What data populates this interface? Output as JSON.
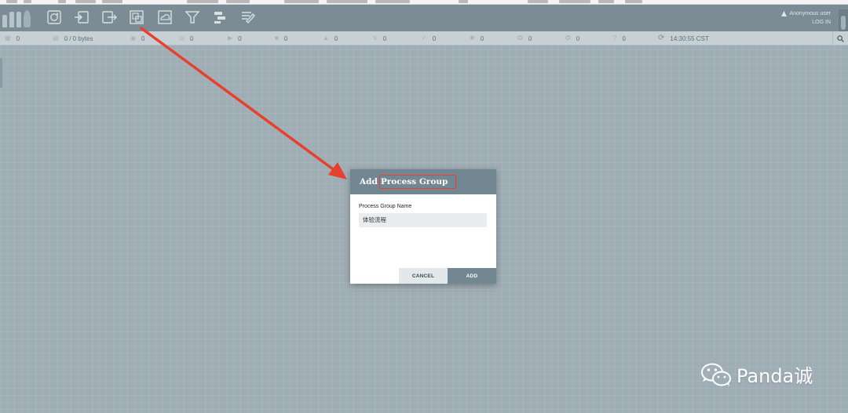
{
  "header": {
    "user_label": "Anonymous user",
    "login_label": "LOG IN",
    "tools": [
      {
        "name": "processor-tool-icon"
      },
      {
        "name": "input-port-tool-icon"
      },
      {
        "name": "output-port-tool-icon"
      },
      {
        "name": "process-group-tool-icon"
      },
      {
        "name": "remote-process-group-tool-icon"
      },
      {
        "name": "funnel-tool-icon"
      },
      {
        "name": "template-tool-icon"
      },
      {
        "name": "label-tool-icon"
      }
    ]
  },
  "status_bar": {
    "items": [
      {
        "icon": "cluster-icon",
        "value": "0"
      },
      {
        "icon": "queued-icon",
        "value": "0 / 0 bytes"
      },
      {
        "icon": "transmitting-icon",
        "value": "0"
      },
      {
        "icon": "not-transmitting-icon",
        "value": "0"
      },
      {
        "icon": "running-icon",
        "value": "0"
      },
      {
        "icon": "stopped-icon",
        "value": "0"
      },
      {
        "icon": "invalid-icon",
        "value": "0"
      },
      {
        "icon": "disabled-icon",
        "value": "0"
      },
      {
        "icon": "up-to-date-icon",
        "value": "0"
      },
      {
        "icon": "locally-modified-icon",
        "value": "0"
      },
      {
        "icon": "stale-icon",
        "value": "0"
      },
      {
        "icon": "locally-modified-stale-icon",
        "value": "0"
      },
      {
        "icon": "sync-failure-icon",
        "value": "0"
      }
    ],
    "refresh_time": "14:30:55 CST"
  },
  "dialog": {
    "title_prefix": "Add",
    "title_highlight": "Process Group",
    "field_label": "Process Group Name",
    "field_value": "体验流程",
    "cancel_label": "CANCEL",
    "add_label": "ADD"
  },
  "watermark": {
    "text": "Panda诚"
  },
  "colors": {
    "canvas": "#9fadb5",
    "header": "#7b8c95",
    "dialog_header": "#728792",
    "annotation_red": "#e8402f"
  }
}
